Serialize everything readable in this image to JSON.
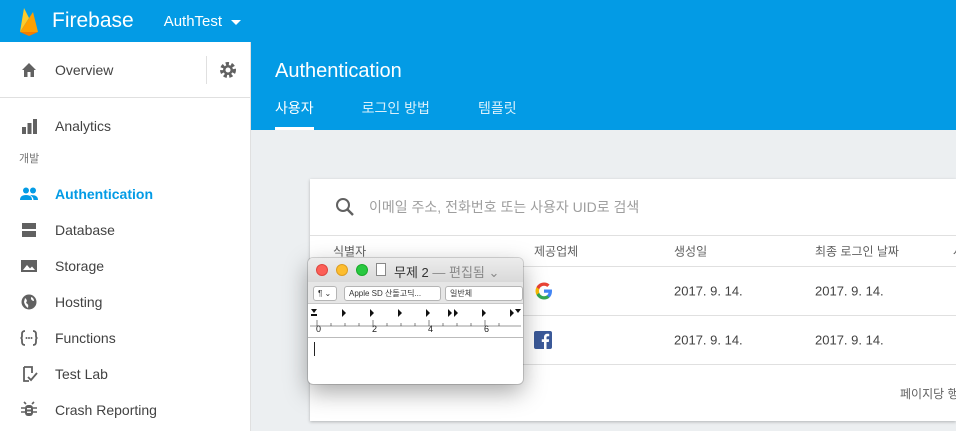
{
  "topbar": {
    "brand": "Firebase",
    "project": "AuthTest"
  },
  "sidebar": {
    "overview": "Overview",
    "analytics": "Analytics",
    "section": "개발",
    "items": [
      {
        "label": "Authentication",
        "icon": "people-icon",
        "active": true
      },
      {
        "label": "Database",
        "icon": "database-icon"
      },
      {
        "label": "Storage",
        "icon": "image-icon"
      },
      {
        "label": "Hosting",
        "icon": "globe-icon"
      },
      {
        "label": "Functions",
        "icon": "functions-icon"
      },
      {
        "label": "Test Lab",
        "icon": "checklist-icon"
      },
      {
        "label": "Crash Reporting",
        "icon": "bug-icon"
      }
    ]
  },
  "header": {
    "title": "Authentication",
    "tabs": [
      {
        "label": "사용자"
      },
      {
        "label": "로그인 방법"
      },
      {
        "label": "템플릿"
      }
    ]
  },
  "search": {
    "placeholder": "이메일 주소, 전화번호 또는 사용자 UID로 검색"
  },
  "table": {
    "headers": [
      "식별자",
      "제공업체",
      "생성일",
      "최종 로그인 날짜",
      "사"
    ],
    "rows": [
      {
        "provider": "Google",
        "created": "2017. 9. 14.",
        "last_login": "2017. 9. 14."
      },
      {
        "provider": "Facebook",
        "created": "2017. 9. 14.",
        "last_login": "2017. 9. 14."
      }
    ],
    "footer": "페이지당 행"
  },
  "mac_window": {
    "title": "무제 2",
    "state": "— 편집됨",
    "style_menu": "¶",
    "font_menu": "Apple SD 산돌고딕...",
    "weight_menu": "일반체",
    "ruler_labels": [
      "0",
      "2",
      "4",
      "6"
    ]
  },
  "colors": {
    "primary": "#039be5",
    "active_nav": "#039be5"
  }
}
